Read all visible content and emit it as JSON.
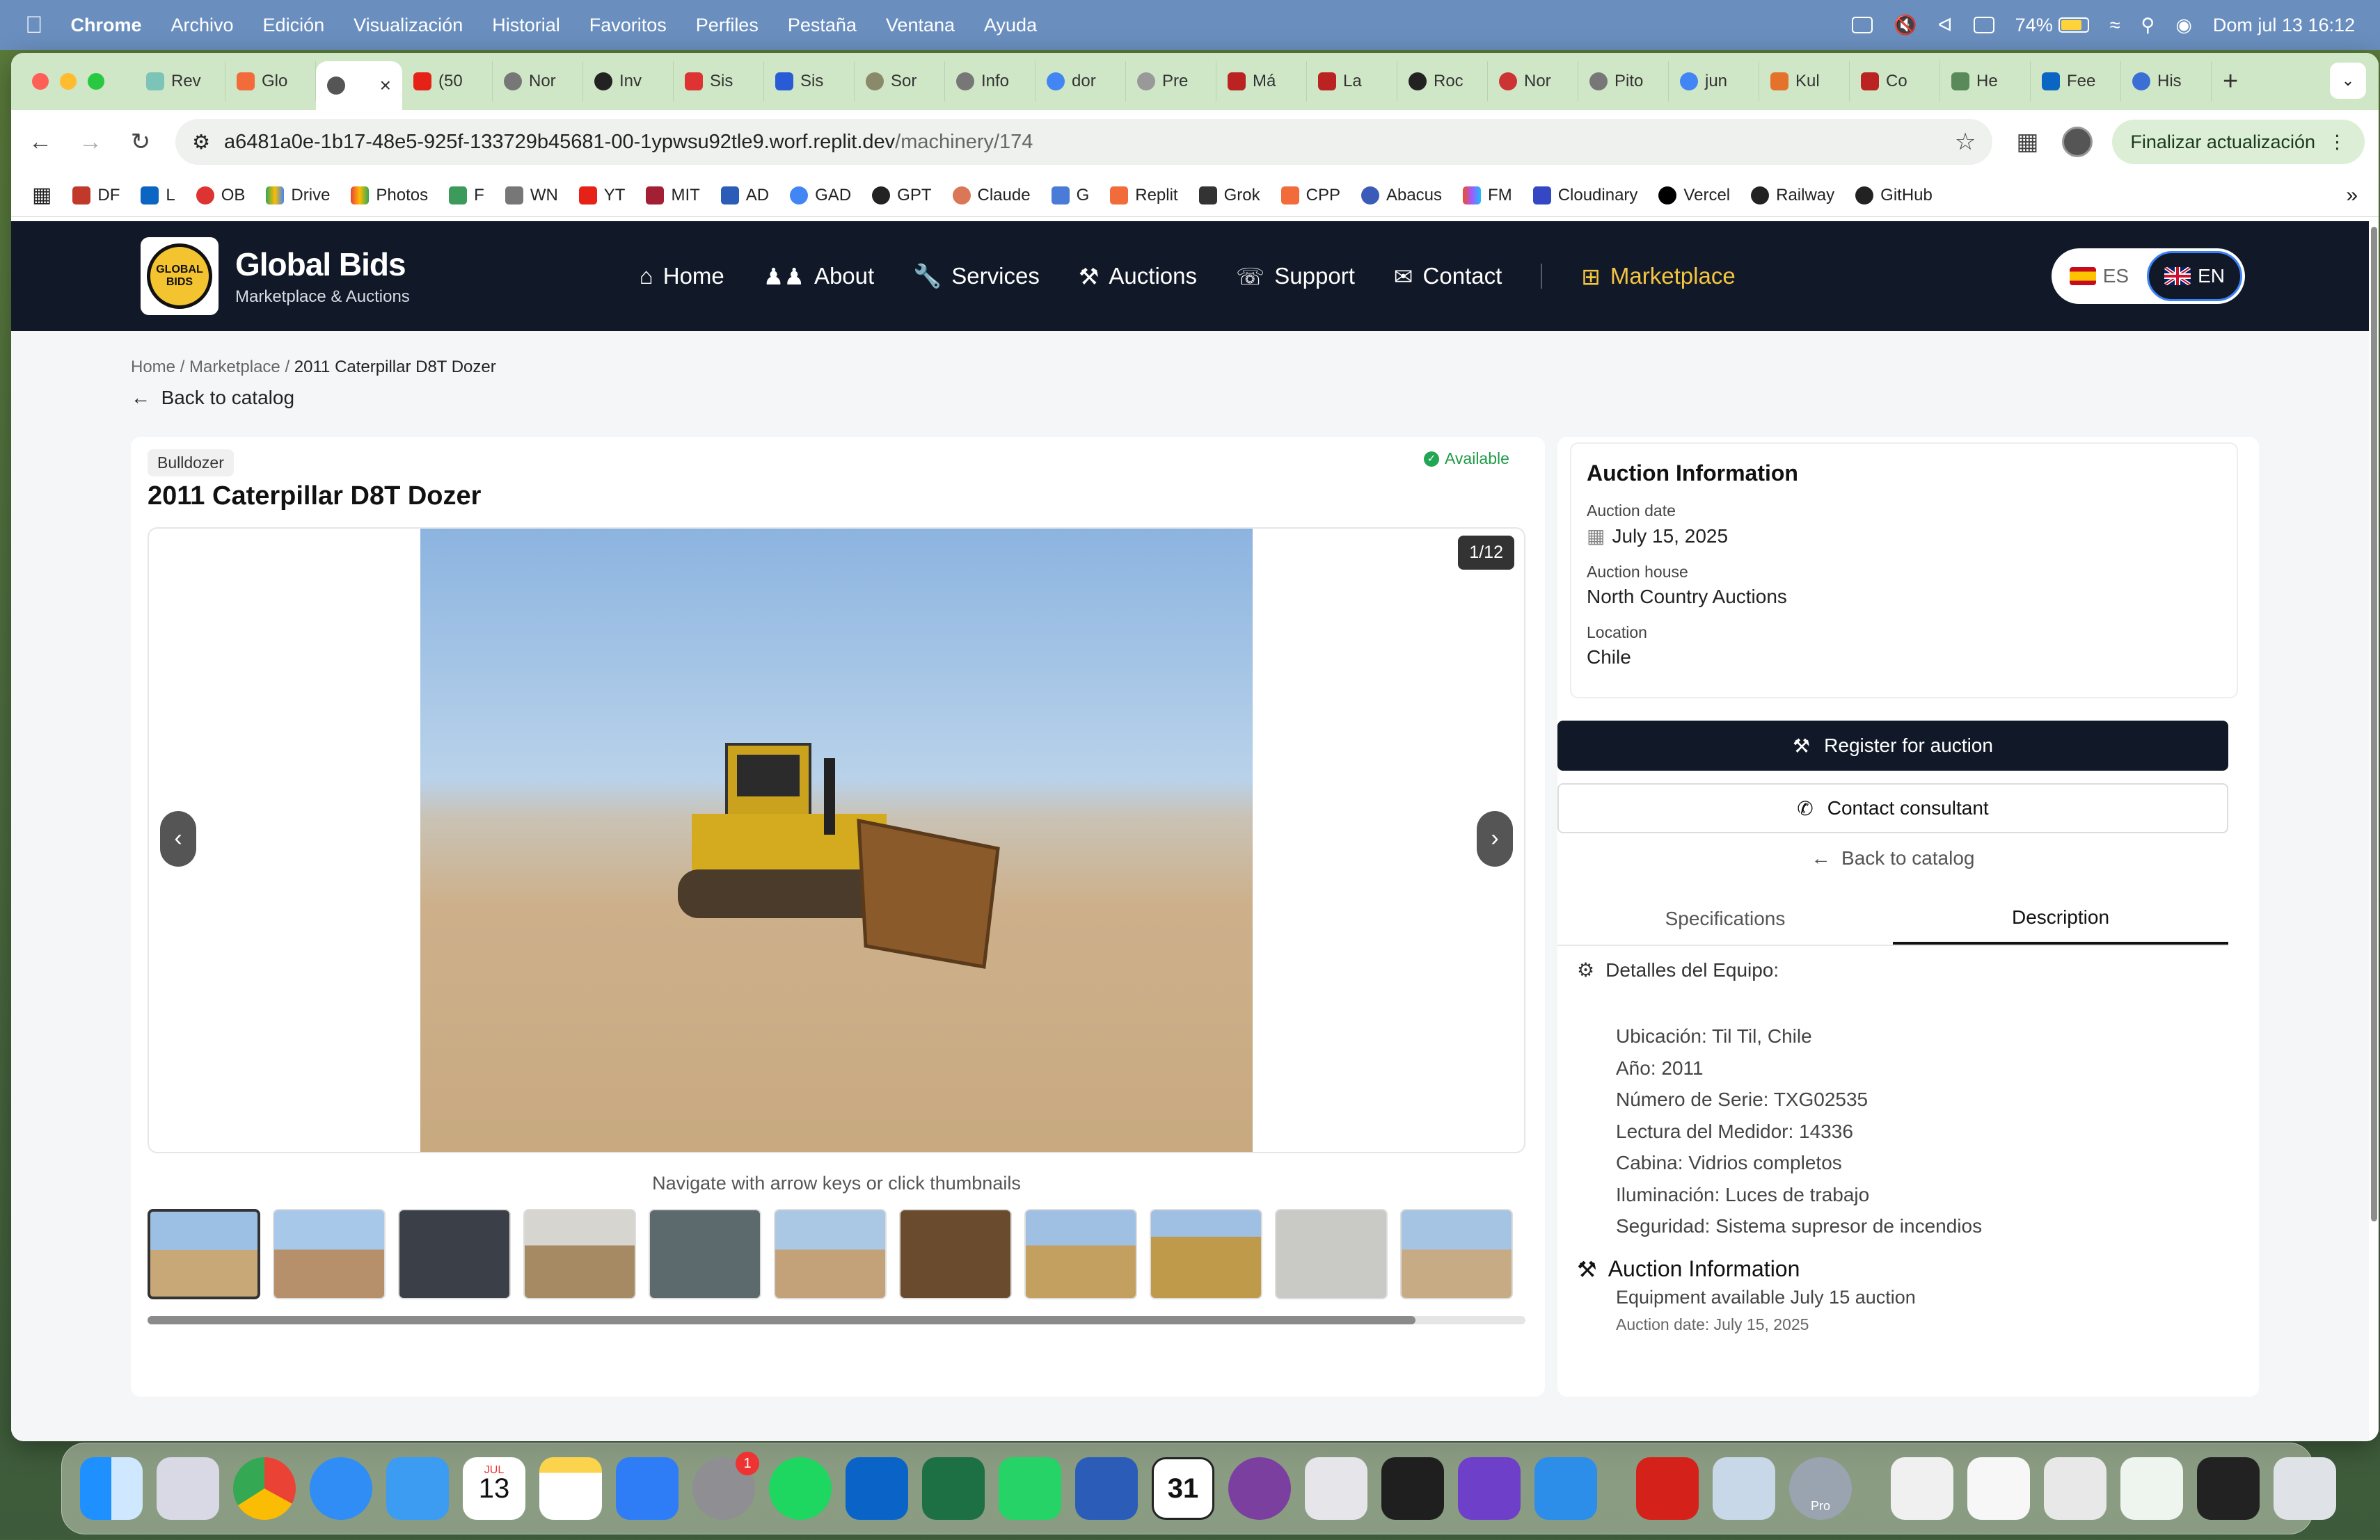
{
  "menubar": {
    "items": [
      "Chrome",
      "Archivo",
      "Edición",
      "Visualización",
      "Historial",
      "Favoritos",
      "Perfiles",
      "Pestaña",
      "Ventana",
      "Ayuda"
    ],
    "battery": "74%",
    "datetime": "Dom jul 13  16:12"
  },
  "browser": {
    "tabs": [
      "Rev",
      "Glo",
      "",
      "(50",
      "Nor",
      "Inv",
      "Sis",
      "Sis",
      "Sor",
      "Info",
      "dor",
      "Pre",
      "Má",
      "La",
      "Roc",
      "Nor",
      "Pito",
      "jun",
      "Kul",
      "Co",
      "He",
      "Fee",
      "His"
    ],
    "active_tab_index": 2,
    "url_host": "a6481a0e-1b17-48e5-925f-133729b45681-00-1ypwsu92tle9.worf.replit.dev",
    "url_path": "/machinery/174",
    "update_button": "Finalizar actualización",
    "bookmarks": [
      "DF",
      "L",
      "OB",
      "Drive",
      "Photos",
      "F",
      "WN",
      "YT",
      "MIT",
      "AD",
      "GAD",
      "GPT",
      "Claude",
      "G",
      "Replit",
      "Grok",
      "CPP",
      "Abacus",
      "FM",
      "Cloudinary",
      "Vercel",
      "Railway",
      "GitHub"
    ]
  },
  "site": {
    "brand": "Global Bids",
    "tagline": "Marketplace & Auctions",
    "logo_text": "GLOBAL BIDS",
    "nav": [
      "Home",
      "About",
      "Services",
      "Auctions",
      "Support",
      "Contact",
      "Marketplace"
    ],
    "lang_es": "ES",
    "lang_en": "EN"
  },
  "breadcrumb": {
    "home": "Home",
    "sep": "/",
    "marketplace": "Marketplace",
    "current": "2011 Caterpillar D8T Dozer"
  },
  "back_to_catalog": "Back to catalog",
  "product": {
    "category": "Bulldozer",
    "status": "Available",
    "title": "2011 Caterpillar D8T Dozer",
    "image_counter": "1/12",
    "gallery_hint": "Navigate with arrow keys or click thumbnails",
    "thumbnail_count": 11
  },
  "auction": {
    "heading": "Auction Information",
    "date_label": "Auction date",
    "date_value": "July 15, 2025",
    "house_label": "Auction house",
    "house_value": "North Country Auctions",
    "location_label": "Location",
    "location_value": "Chile"
  },
  "actions": {
    "register": "Register for auction",
    "contact": "Contact consultant",
    "back": "Back to catalog"
  },
  "detail_tabs": {
    "specs": "Specifications",
    "description": "Description"
  },
  "description": {
    "heading": "Detalles del Equipo:",
    "lines": [
      "Ubicación: Til Til, Chile",
      "Año: 2011",
      "Número de Serie: TXG02535",
      "Lectura del Medidor: 14336",
      "Cabina: Vidrios completos",
      "Iluminación: Luces de trabajo",
      "Seguridad: Sistema supresor de incendios"
    ],
    "auction_heading": "Auction Information",
    "auction_sub": "Equipment available July 15 auction",
    "auction_date": "Auction date: July 15, 2025"
  },
  "dock": {
    "calendar_month": "JUL",
    "calendar_day": "13",
    "settings_badge": "1",
    "cal31": "31",
    "pro": "Pro"
  }
}
